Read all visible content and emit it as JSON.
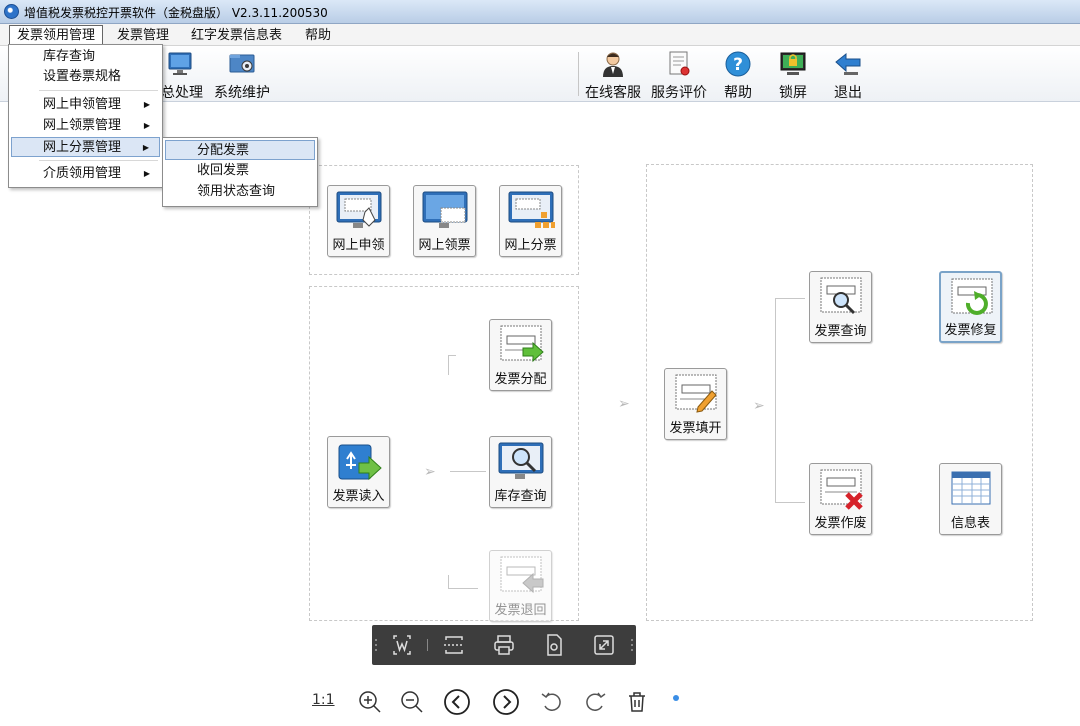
{
  "window": {
    "title": "增值税发票税控开票软件（金税盘版） V2.3.11.200530"
  },
  "menubar": {
    "items": [
      {
        "label": "发票领用管理"
      },
      {
        "label": "发票管理"
      },
      {
        "label": "红字发票信息表"
      },
      {
        "label": "帮助"
      }
    ]
  },
  "dropdown": {
    "items": [
      {
        "label": "库存查询"
      },
      {
        "label": "设置卷票规格"
      },
      {
        "label": "网上申领管理"
      },
      {
        "label": "网上领票管理"
      },
      {
        "label": "网上分票管理"
      },
      {
        "label": "介质领用管理"
      }
    ],
    "submenu": [
      {
        "label": "分配发票"
      },
      {
        "label": "收回发票"
      },
      {
        "label": "领用状态查询"
      }
    ]
  },
  "toolbar": {
    "left": [
      {
        "label": "总处理",
        "icon": "monitor-icon"
      },
      {
        "label": "系统维护",
        "icon": "system-maintain-icon"
      }
    ],
    "right": [
      {
        "label": "在线客服",
        "icon": "customer-service-icon"
      },
      {
        "label": "服务评价",
        "icon": "service-rating-icon"
      },
      {
        "label": "帮助",
        "icon": "help-icon"
      },
      {
        "label": "锁屏",
        "icon": "lock-screen-icon"
      },
      {
        "label": "退出",
        "icon": "exit-icon"
      }
    ]
  },
  "tiles": {
    "online_apply": "网上申领",
    "online_receive": "网上领票",
    "online_distribute": "网上分票",
    "invoice_distribute": "发票分配",
    "invoice_read": "发票读入",
    "stock_query": "库存查询",
    "invoice_return": "发票退回",
    "invoice_fill": "发票填开",
    "invoice_query": "发票查询",
    "invoice_repair": "发票修复",
    "invoice_void": "发票作废",
    "info_table": "信息表"
  },
  "bottombar": {
    "zoom_label": "1:1"
  },
  "colors": {
    "accent": "#2e73c9",
    "highlight": "#dbe6f5",
    "viewer_bg": "#3d3d3d",
    "dot": "#3a8ee6"
  }
}
